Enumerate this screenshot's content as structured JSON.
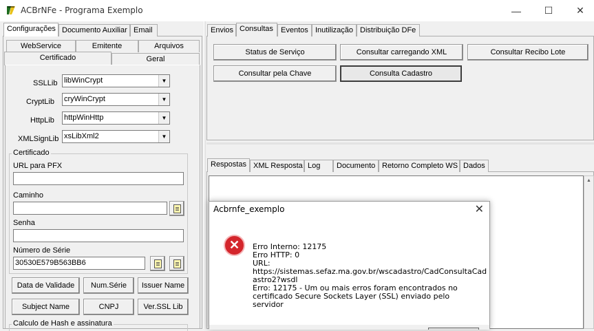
{
  "window": {
    "title": "ACBrNFe - Programa Exemplo",
    "minimize": "—",
    "maximize": "☐",
    "close": "✕"
  },
  "left_tabs": [
    "Configurações",
    "Documento Auxiliar",
    "Email"
  ],
  "config_subtabs_row1": [
    "WebService",
    "Emitente",
    "Arquivos"
  ],
  "config_subtabs_row2": [
    "Certificado",
    "Geral"
  ],
  "cert_libs": [
    {
      "label": "SSLLib",
      "value": "libWinCrypt"
    },
    {
      "label": "CryptLib",
      "value": "cryWinCrypt"
    },
    {
      "label": "HttpLib",
      "value": "httpWinHttp"
    },
    {
      "label": "XMLSignLib",
      "value": "xsLibXml2"
    }
  ],
  "certificado_group": {
    "title": "Certificado",
    "url_label": "URL para PFX",
    "url_value": "",
    "caminho_label": "Caminho",
    "caminho_value": "",
    "senha_label": "Senha",
    "senha_value": "",
    "serie_label": "Número de Série",
    "serie_value": "30530E579B563BB6"
  },
  "cert_buttons_row1": [
    "Data de Validade",
    "Num.Série",
    "Issuer Name"
  ],
  "cert_buttons_row2": [
    "Subject Name",
    "CNPJ",
    "Ver.SSL Lib"
  ],
  "hash_group_title": "Calculo de Hash e assinatura",
  "right_tabs": [
    "Envios",
    "Consultas",
    "Eventos",
    "Inutilização",
    "Distribuição DFe"
  ],
  "consultas_buttons": [
    "Status de Serviço",
    "Consultar carregando XML",
    "Consultar Recibo Lote",
    "Consultar pela Chave",
    "Consulta Cadastro"
  ],
  "response_tabs": [
    "Respostas",
    "XML Resposta",
    "Log",
    "Documento",
    "Retorno Completo WS",
    "Dados"
  ],
  "dialog": {
    "title": "Acbrnfe_exemplo",
    "close": "✕",
    "icon": "error-icon",
    "message": "Erro Interno: 12175\nErro HTTP: 0\nURL:\nhttps://sistemas.sefaz.ma.gov.br/wscadastro/CadConsultaCad\nastro2?wsdl\nErro: 12175 - Um ou mais erros foram encontrados no\ncertificado Secure Sockets Layer (SSL) enviado pelo servidor"
  },
  "colors": {
    "error_red": "#d4262c",
    "window_bg": "#f0f0f0"
  }
}
